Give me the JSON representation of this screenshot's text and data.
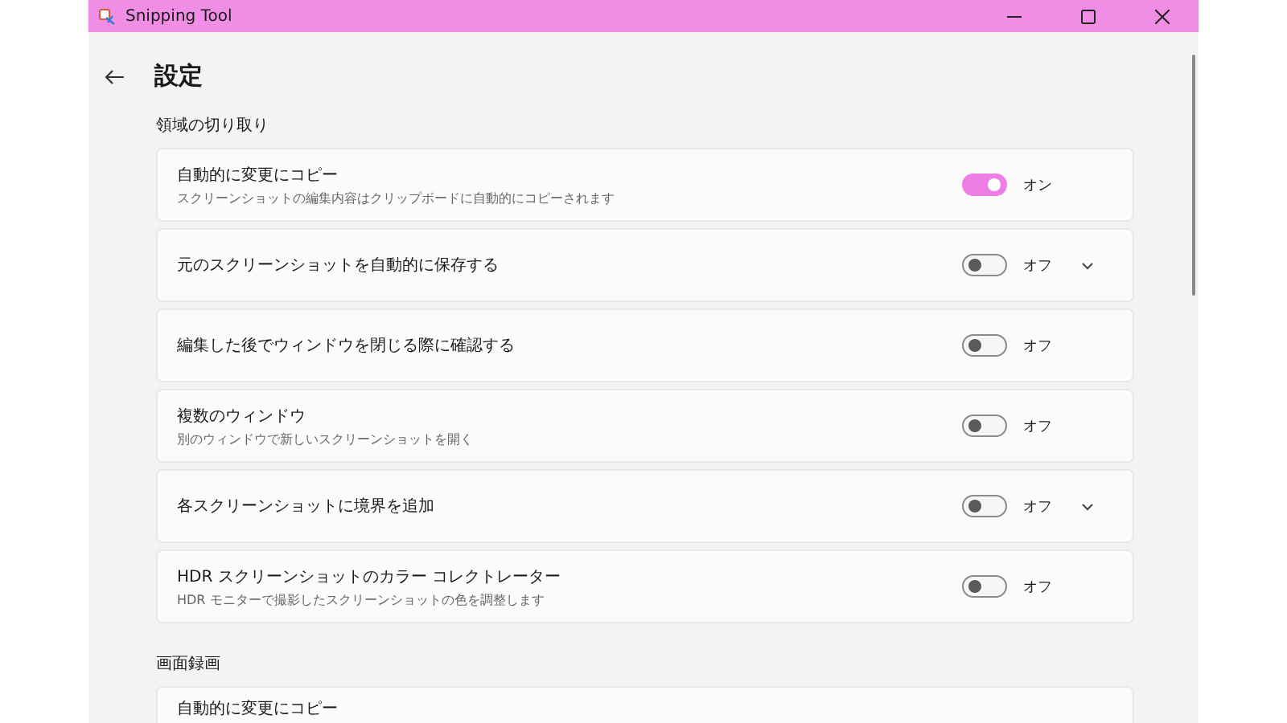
{
  "window": {
    "title": "Snipping Tool"
  },
  "page": {
    "title": "設定"
  },
  "sections": [
    {
      "title": "領域の切り取り",
      "items": [
        {
          "title": "自動的に変更にコピー",
          "description": "スクリーンショットの編集内容はクリップボードに自動的にコピーされます",
          "toggle": {
            "on": true,
            "label": "オン"
          },
          "expandable": false
        },
        {
          "title": "元のスクリーンショットを自動的に保存する",
          "toggle": {
            "on": false,
            "label": "オフ"
          },
          "expandable": true
        },
        {
          "title": "編集した後でウィンドウを閉じる際に確認する",
          "toggle": {
            "on": false,
            "label": "オフ"
          },
          "expandable": false
        },
        {
          "title": "複数のウィンドウ",
          "description": "別のウィンドウで新しいスクリーンショットを開く",
          "toggle": {
            "on": false,
            "label": "オフ"
          },
          "expandable": false
        },
        {
          "title": "各スクリーンショットに境界を追加",
          "toggle": {
            "on": false,
            "label": "オフ"
          },
          "expandable": true
        },
        {
          "title": "HDR スクリーンショットのカラー コレクトレーター",
          "description": "HDR モニターで撮影したスクリーンショットの色を調整します",
          "toggle": {
            "on": false,
            "label": "オフ"
          },
          "expandable": false
        }
      ]
    },
    {
      "title": "画面録画",
      "items": [
        {
          "title": "自動的に変更にコピー"
        }
      ]
    }
  ]
}
